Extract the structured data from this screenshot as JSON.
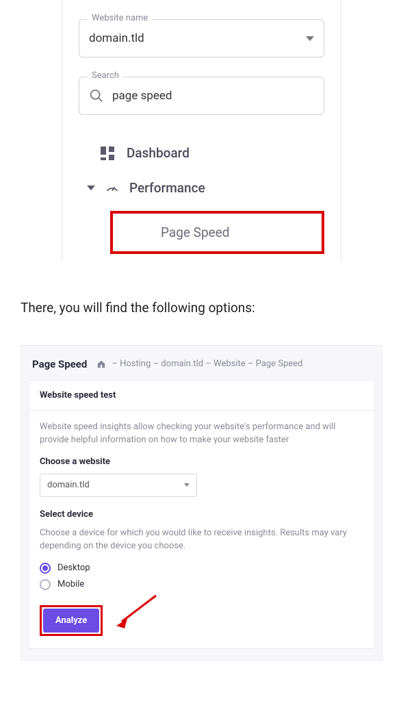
{
  "panel1": {
    "website_name_label": "Website name",
    "website_name_value": "domain.tld",
    "search_label": "Search",
    "search_value": "page speed",
    "nav": {
      "dashboard": "Dashboard",
      "performance": "Performance",
      "page_speed": "Page Speed"
    }
  },
  "body_text": "There, you will find the following options:",
  "panel2": {
    "title": "Page Speed",
    "breadcrumb": {
      "hosting": "Hosting",
      "domain": "domain.tld",
      "website": "Website",
      "page_speed": "Page Speed"
    },
    "card": {
      "heading": "Website speed test",
      "description": "Website speed insights allow checking your website's performance and will provide helpful information on how to make your website faster",
      "choose_website_label": "Choose a website",
      "choose_website_value": "domain.tld",
      "select_device_label": "Select device",
      "select_device_desc": "Choose a device for which you would like to receive insights. Results may vary depending on the device you choose.",
      "radio_desktop": "Desktop",
      "radio_mobile": "Mobile",
      "analyze_label": "Analyze"
    }
  }
}
